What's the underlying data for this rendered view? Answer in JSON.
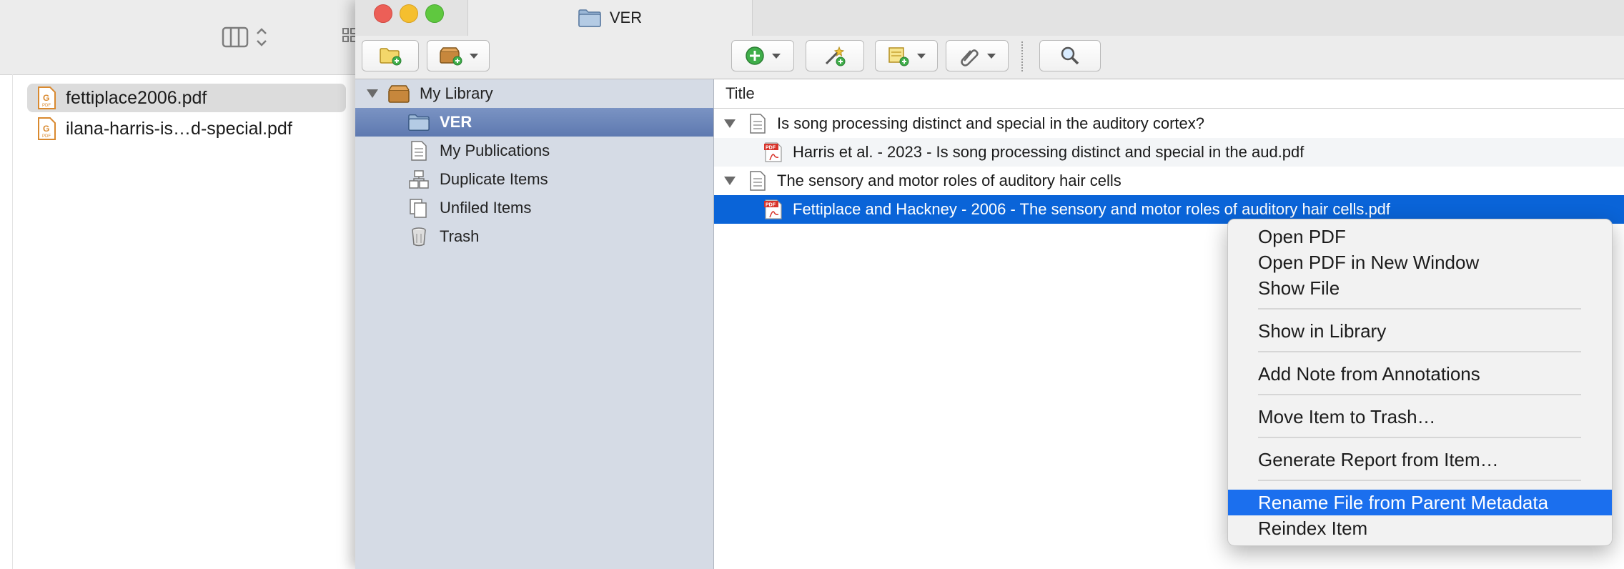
{
  "finder": {
    "files": [
      {
        "name": "fettiplace2006.pdf",
        "icon": "pdf-file-icon",
        "selected": true
      },
      {
        "name": "ilana-harris-is…d-special.pdf",
        "icon": "pdf-file-icon",
        "selected": false
      }
    ]
  },
  "window": {
    "tab_title": "VER",
    "tab_icon": "folder-icon"
  },
  "toolbar": {
    "buttons": [
      "new-collection",
      "new-library",
      "new-item",
      "add-by-identifier",
      "new-note",
      "add-attachment",
      "search"
    ]
  },
  "collections": {
    "library": "My Library",
    "items": [
      "VER",
      "My Publications",
      "Duplicate Items",
      "Unfiled Items",
      "Trash"
    ],
    "selected": "VER"
  },
  "items": {
    "column_title": "Title",
    "rows": [
      {
        "title": "Is song processing distinct and special in the auditory cortex?",
        "type": "document"
      },
      {
        "title": "Harris et al. - 2023 - Is song processing distinct and special in the aud.pdf",
        "type": "pdf"
      },
      {
        "title": "The sensory and motor roles of auditory hair cells",
        "type": "document"
      },
      {
        "title": "Fettiplace and Hackney - 2006 - The sensory and motor roles of auditory hair cells.pdf",
        "type": "pdf",
        "selected": true
      }
    ]
  },
  "context_menu": {
    "items": [
      "Open PDF",
      "Open PDF in New Window",
      "Show File",
      "Show in Library",
      "Add Note from Annotations",
      "Move Item to Trash…",
      "Generate Report from Item…",
      "Rename File from Parent Metadata",
      "Reindex Item"
    ],
    "highlighted": "Rename File from Parent Metadata"
  },
  "colors": {
    "selection_blue": "#0a64d8",
    "menu_highlight": "#1b6fee",
    "collection_selected": "#6a84b8",
    "collections_bg": "#d5dbe5"
  }
}
